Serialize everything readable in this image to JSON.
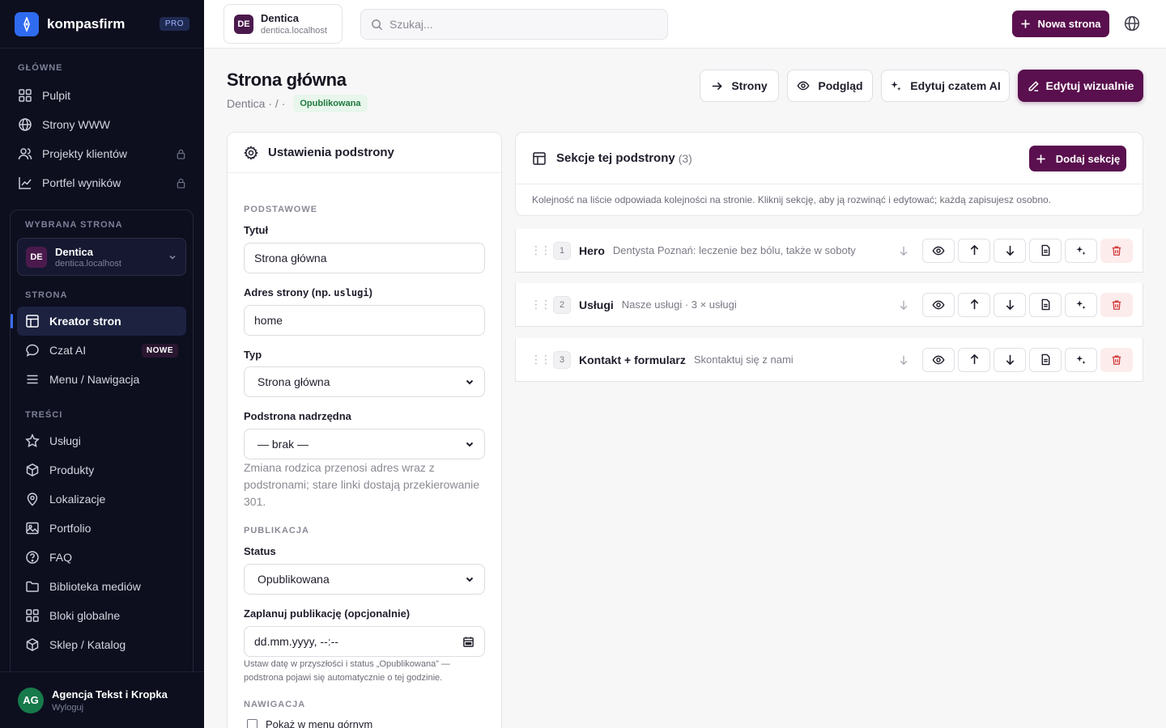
{
  "brand": {
    "name": "kompasfirm",
    "badge": "PRO"
  },
  "sidebar": {
    "main_label": "GŁÓWNE",
    "main_items": [
      {
        "label": "Pulpit",
        "icon": "grid-icon"
      },
      {
        "label": "Strony WWW",
        "icon": "globe-icon"
      },
      {
        "label": "Projekty klientów",
        "icon": "users-icon",
        "locked": true
      },
      {
        "label": "Portfel wyników",
        "icon": "chart-icon",
        "locked": true
      }
    ],
    "selected_label": "WYBRANA STRONA",
    "selected_site": {
      "initials": "DE",
      "name": "Dentica",
      "domain": "dentica.localhost"
    },
    "page_label": "STRONA",
    "page_items": [
      {
        "label": "Kreator stron",
        "icon": "layout-icon",
        "active": true
      },
      {
        "label": "Czat AI",
        "icon": "chat-icon",
        "badge": "NOWE"
      },
      {
        "label": "Menu / Nawigacja",
        "icon": "menu-icon"
      }
    ],
    "content_label": "TREŚCI",
    "content_items": [
      {
        "label": "Usługi",
        "icon": "star-icon"
      },
      {
        "label": "Produkty",
        "icon": "box-icon"
      },
      {
        "label": "Lokalizacje",
        "icon": "pin-icon"
      },
      {
        "label": "Portfolio",
        "icon": "image-icon"
      },
      {
        "label": "FAQ",
        "icon": "help-icon"
      },
      {
        "label": "Biblioteka mediów",
        "icon": "folder-icon"
      },
      {
        "label": "Bloki globalne",
        "icon": "blocks-icon"
      },
      {
        "label": "Sklep / Katalog",
        "icon": "box-icon"
      }
    ],
    "user": {
      "initials": "AG",
      "name": "Agencja Tekst i Kropka",
      "action": "Wyloguj"
    }
  },
  "topbar": {
    "site": {
      "initials": "DE",
      "name": "Dentica",
      "domain": "dentica.localhost"
    },
    "search_placeholder": "Szukaj...",
    "new_page": "Nowa strona"
  },
  "page": {
    "title": "Strona główna",
    "breadcrumb": "Dentica · / ·",
    "status_badge": "Opublikowana",
    "actions": {
      "pages": "Strony",
      "preview": "Podgląd",
      "ai_edit": "Edytuj czatem AI",
      "visual_edit": "Edytuj wizualnie"
    }
  },
  "settings": {
    "header": "Ustawienia podstrony",
    "basic_label": "PODSTAWOWE",
    "title_label": "Tytuł",
    "title_value": "Strona główna",
    "slug_label_prefix": "Adres strony (np. ",
    "slug_label_code": "uslugi",
    "slug_label_suffix": ")",
    "slug_value": "home",
    "type_label": "Typ",
    "type_value": "Strona główna",
    "parent_label": "Podstrona nadrzędna",
    "parent_value": "— brak —",
    "parent_hint": "Zmiana rodzica przenosi adres wraz z podstronami; stare linki dostają przekierowanie 301.",
    "publish_label": "PUBLIKACJA",
    "status_label": "Status",
    "status_value": "Opublikowana",
    "schedule_label": "Zaplanuj publikację (opcjonalnie)",
    "schedule_value": "dd.mm.yyyy, --:--",
    "schedule_hint": "Ustaw datę w przyszłości i status „Opublikowana” — podstrona pojawi się automatycznie o tej godzinie.",
    "nav_label": "NAWIGACJA",
    "nav_checkbox": "Pokaż w menu górnym"
  },
  "sections": {
    "header": "Sekcje tej podstrony",
    "count": "(3)",
    "add": "Dodaj sekcję",
    "description": "Kolejność na liście odpowiada kolejności na stronie. Kliknij sekcję, aby ją rozwinąć i edytować; każdą zapisujesz osobno.",
    "items": [
      {
        "num": "1",
        "name": "Hero",
        "subtitle": "Dentysta Poznań: leczenie bez bólu, także w soboty"
      },
      {
        "num": "2",
        "name": "Usługi",
        "subtitle": "Nasze usługi · 3 × usługi"
      },
      {
        "num": "3",
        "name": "Kontakt + formularz",
        "subtitle": "Skontaktuj się z nami"
      }
    ]
  },
  "colors": {
    "accent": "#5a0f4e",
    "sidebar": "#0d0f1f",
    "brand_blue": "#2f6bf0"
  }
}
